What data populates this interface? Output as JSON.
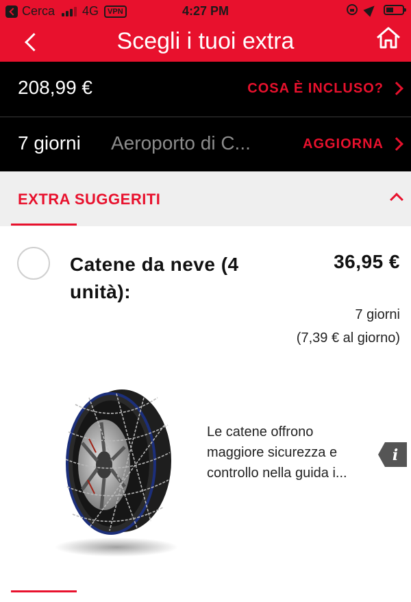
{
  "status_bar": {
    "back_app": "Cerca",
    "network": "4G",
    "vpn": "VPN",
    "time": "4:27 PM"
  },
  "header": {
    "title": "Scegli i tuoi extra"
  },
  "summary": {
    "total_price": "208,99 €",
    "included_link": "COSA È INCLUSO?",
    "duration": "7 giorni",
    "location": "Aeroporto di C...",
    "update_link": "AGGIORNA"
  },
  "section": {
    "title": "EXTRA SUGGERITI"
  },
  "extra_item": {
    "name": "Catene da neve (4 unità):",
    "price": "36,95 €",
    "duration": "7 giorni",
    "per_day": "(7,39 € al giorno)",
    "description": "Le catene offrono maggiore sicurezza e controllo nella guida i..."
  },
  "colors": {
    "brand_red": "#e8112d",
    "dark_bar": "#000000",
    "section_bg": "#efefef"
  },
  "icons": [
    "back-icon",
    "home-icon",
    "chevron-right-icon",
    "chevron-up-icon",
    "radio-unchecked",
    "info-icon"
  ]
}
